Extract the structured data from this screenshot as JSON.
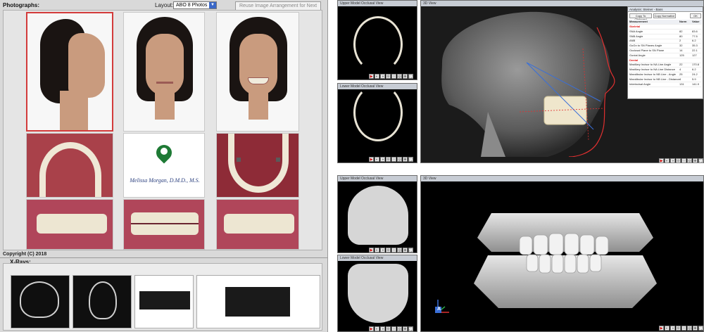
{
  "left_panel": {
    "photographs_label": "Photographs:",
    "layout_label": "Layout:",
    "layout_value": "ABO 8 Photos",
    "reuse_button": "Reuse Image Arrangement for Next Import",
    "logo_text": "Melissa Morgan, D.M.D., M.S.",
    "copyright": "Copyright (C) 2018",
    "xrays_label": "X-Rays:"
  },
  "right_top": {
    "upper_view_title": "Upper Model Occlusal View",
    "lower_view_title": "Lower Model Occlusal View",
    "ceph_title": "3D View",
    "toolbar": [
      "▶",
      "◐",
      "◑",
      "⊙",
      "○",
      "◎",
      "⊕",
      "⛶"
    ],
    "analysis": {
      "title": "Analysis: Steiner - Bass",
      "buttons": [
        "Copy To Clipboard",
        "Copy Normative",
        "OK"
      ],
      "columns": [
        "Measurement",
        "Norm",
        "Value"
      ],
      "rows": [
        {
          "name": "Skeletal",
          "norm": "",
          "value": "",
          "section": true
        },
        {
          "name": "SNA Angle",
          "norm": "82",
          "value": "83.6"
        },
        {
          "name": "SNB Angle",
          "norm": "80",
          "value": "77.5"
        },
        {
          "name": "ANB",
          "norm": "2",
          "value": "6.2"
        },
        {
          "name": "GoGn to SN Planes Angle",
          "norm": "32",
          "value": "35.3"
        },
        {
          "name": "Occlusal Plane to SN Plane",
          "norm": "14",
          "value": "22.1"
        },
        {
          "name": "Gonial Angle",
          "norm": "125",
          "value": "127"
        },
        {
          "name": "Dental",
          "norm": "",
          "value": "",
          "section": true
        },
        {
          "name": "Maxillary Incisor to NA Line Angle",
          "norm": "22",
          "value": "170.8"
        },
        {
          "name": "Maxillary Incisor to NA Line Distance",
          "norm": "4",
          "value": "6.2"
        },
        {
          "name": "Mandibular Incisor to NB Line - Angle",
          "norm": "25",
          "value": "24.2"
        },
        {
          "name": "Mandibular Incisor to NB Line - Distance",
          "norm": "4",
          "value": "5.9"
        },
        {
          "name": "Interincisal Angle",
          "norm": "131",
          "value": "141.9"
        }
      ]
    }
  },
  "right_bottom": {
    "upper_view_title": "Upper Model Occlusal View",
    "lower_view_title": "Lower Model Occlusal View",
    "view3d_title": "3D View",
    "axis_label": "A"
  },
  "colors": {
    "selection_border": "#d33b3b",
    "layout_dropdown": "#3a68c8",
    "ceph_tracing_red": "#e03030",
    "ceph_tracing_blue": "#3a6fd8"
  }
}
